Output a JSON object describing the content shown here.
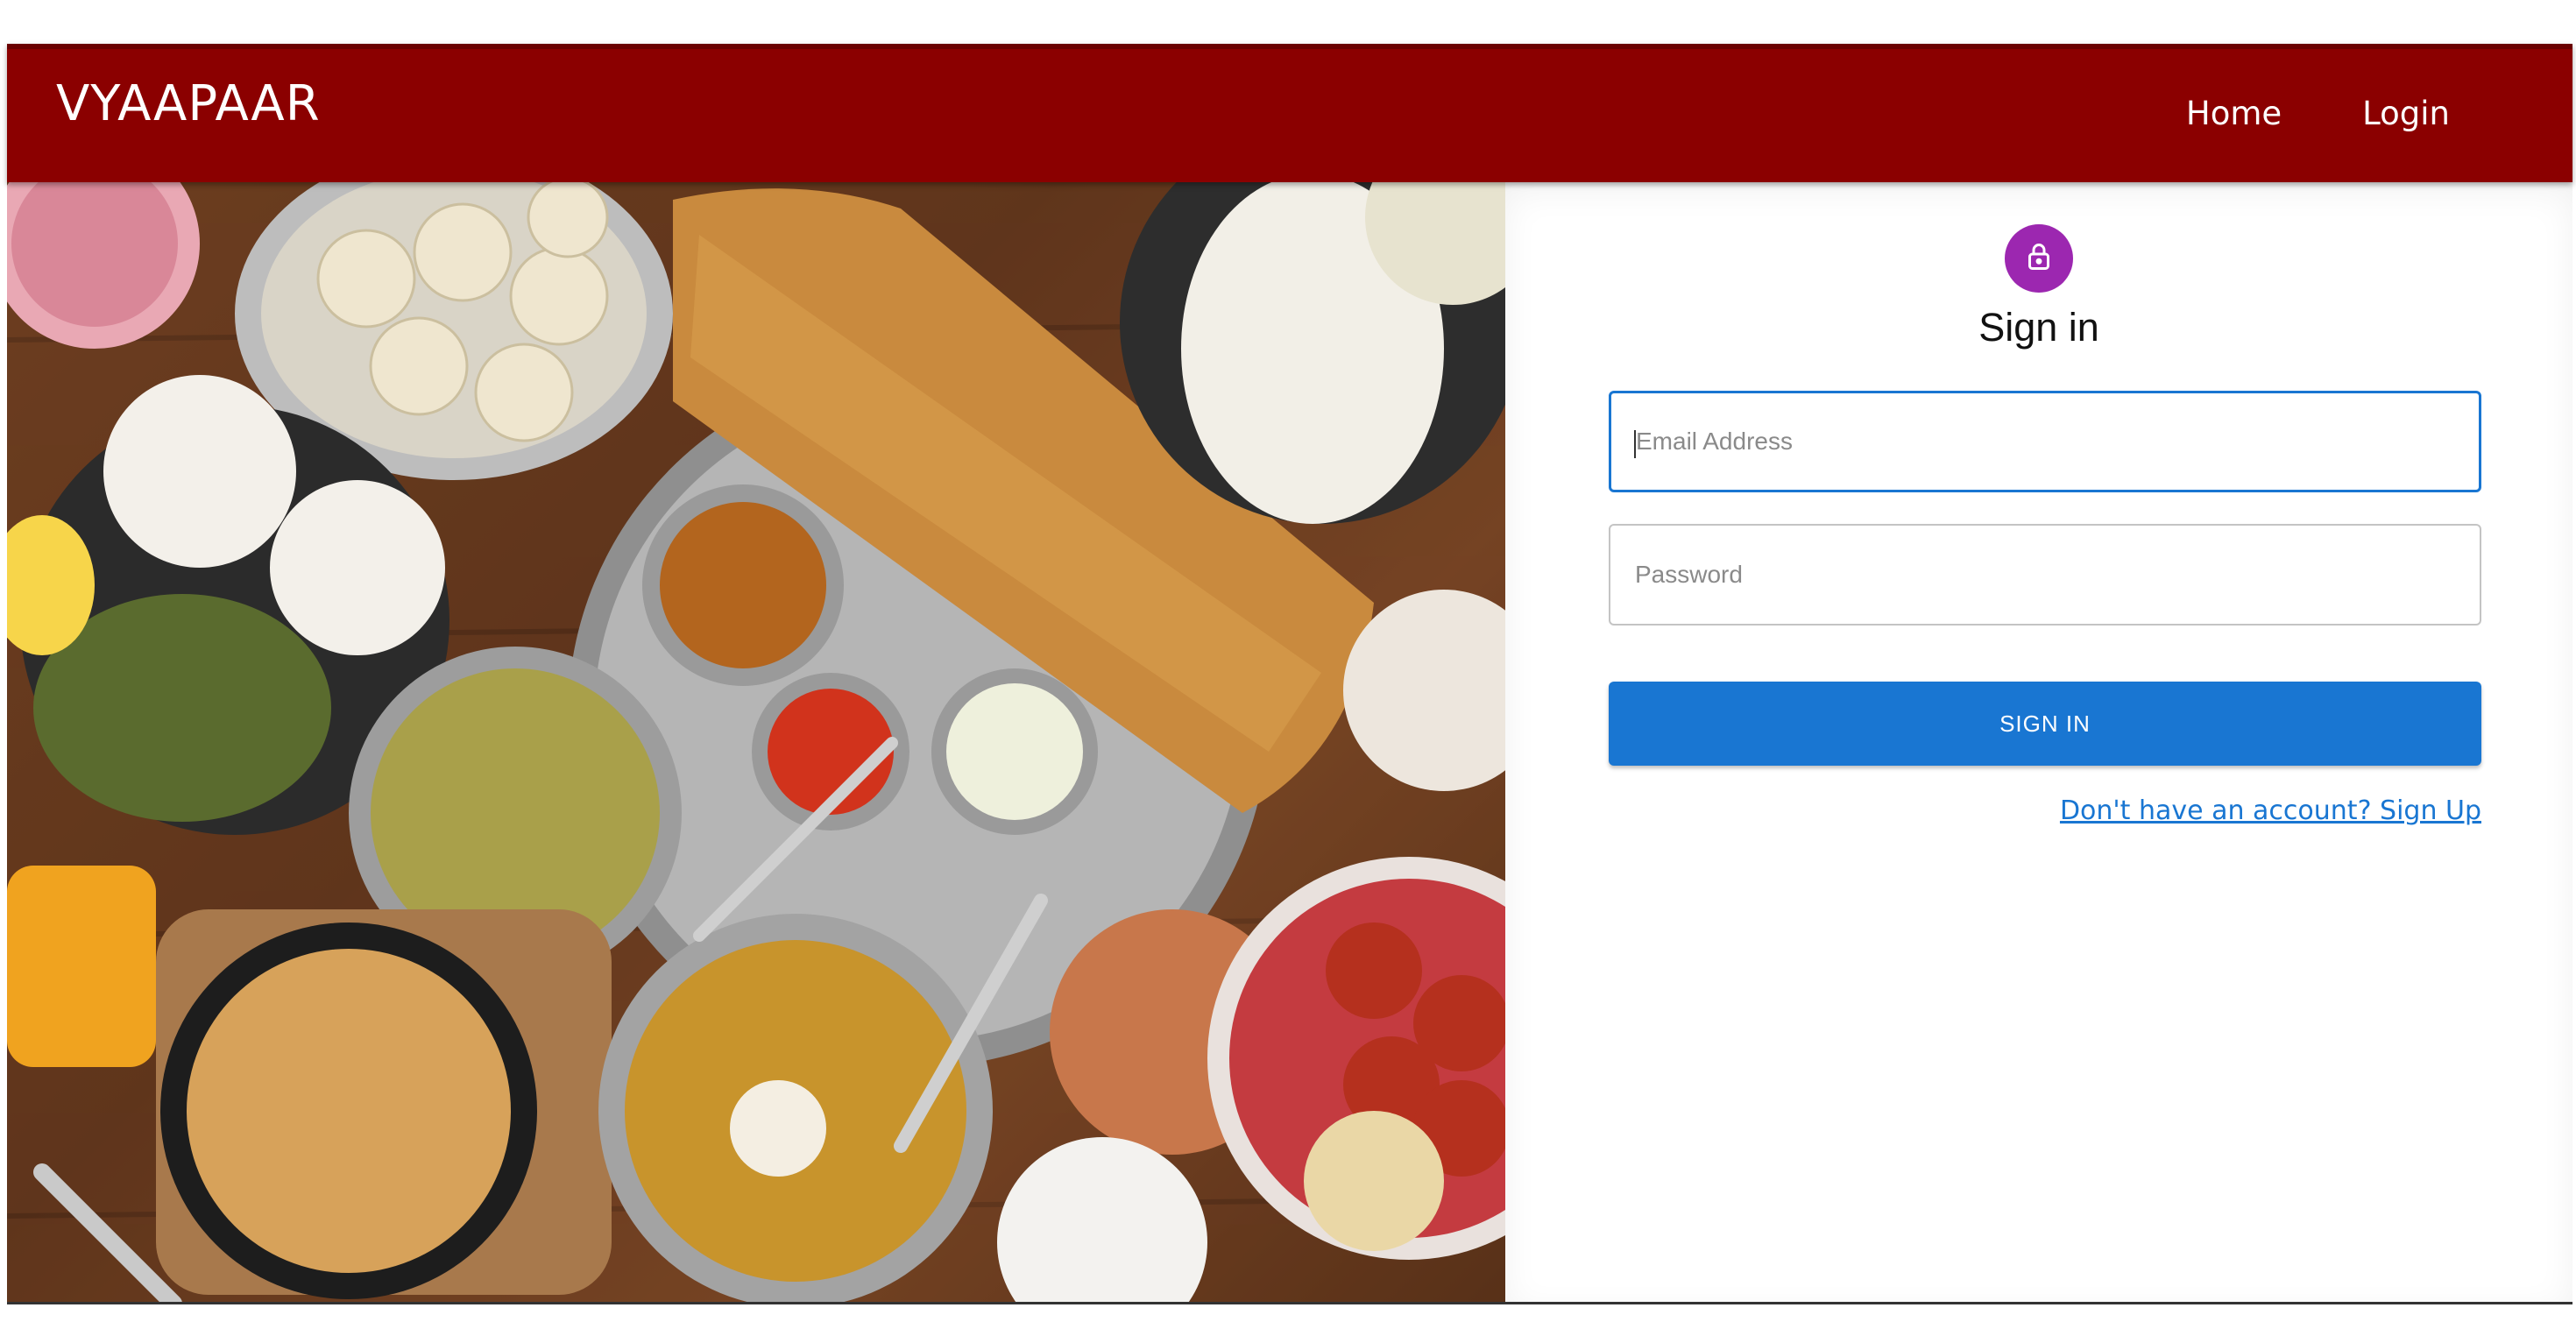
{
  "header": {
    "brand": "VYAAPAAR",
    "nav": [
      {
        "label": "Home"
      },
      {
        "label": "Login"
      }
    ],
    "bg_color": "#8b0000"
  },
  "hero": {
    "icon": "food-collage-image"
  },
  "signin": {
    "avatar_icon": "lock-icon",
    "avatar_color": "#9c27b0",
    "title": "Sign in",
    "email": {
      "placeholder": "Email Address",
      "value": ""
    },
    "password": {
      "placeholder": "Password",
      "value": ""
    },
    "button_label": "SIGN IN",
    "button_color": "#1976d2",
    "signup_link": "Don't have an account? Sign Up"
  }
}
